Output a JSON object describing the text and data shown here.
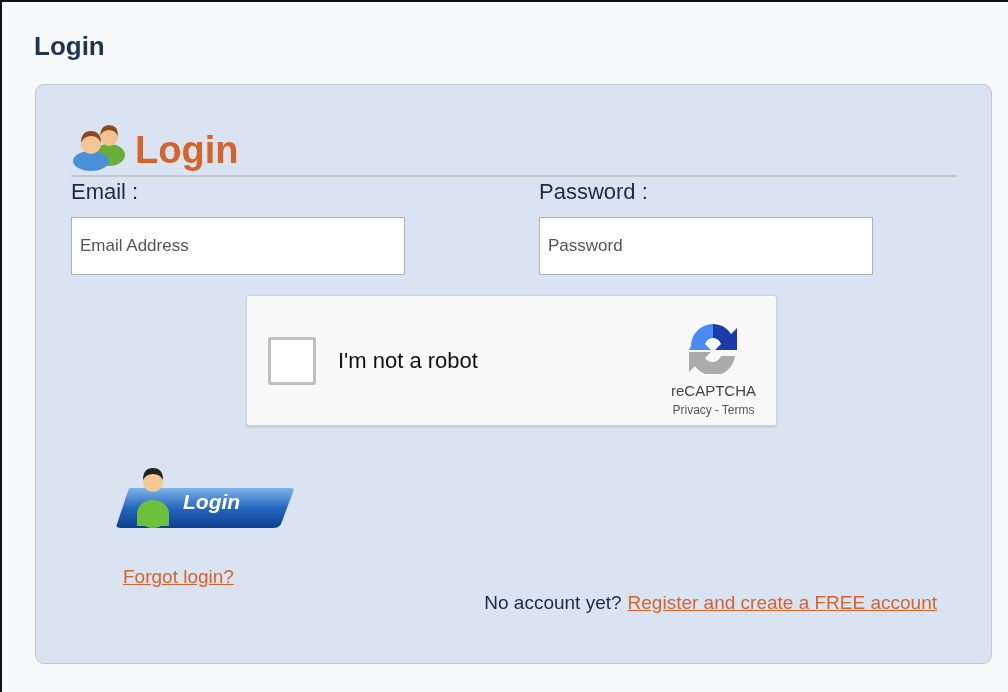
{
  "page_title": "Login",
  "panel": {
    "heading": "Login",
    "email": {
      "label": "Email :",
      "placeholder": "Email Address"
    },
    "password": {
      "label": "Password :",
      "placeholder": "Password"
    },
    "captcha": {
      "checked": false,
      "label": "I'm not a robot",
      "brand": "reCAPTCHA",
      "privacy": "Privacy",
      "separator": "-",
      "terms": "Terms"
    },
    "login_button": "Login",
    "forgot_link": "Forgot login?",
    "register_prompt": "No account yet?",
    "register_link": "Register and create a FREE account"
  }
}
